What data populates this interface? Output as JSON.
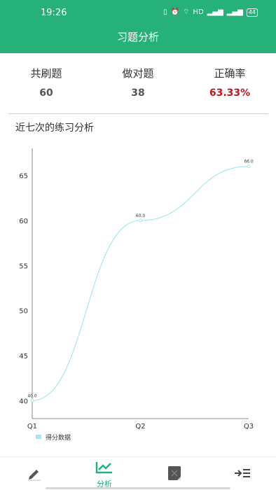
{
  "status": {
    "time": "19:26",
    "network": "HD",
    "battery": "44"
  },
  "app_bar": {
    "title": "习题分析"
  },
  "stats": [
    {
      "label": "共刷题",
      "value": "60"
    },
    {
      "label": "做对题",
      "value": "38"
    },
    {
      "label": "正确率",
      "value": "63.33%"
    }
  ],
  "section": {
    "title": "近七次的练习分析"
  },
  "chart_data": {
    "type": "line",
    "categories": [
      "Q1",
      "Q2",
      "Q3"
    ],
    "series": [
      {
        "name": "得分数据",
        "values": [
          40.0,
          60.0,
          66.0
        ],
        "color": "#a8e6f3"
      }
    ],
    "data_labels": [
      "40.0",
      "60.0",
      "66.0"
    ],
    "yticks": [
      "40",
      "45",
      "50",
      "55",
      "60",
      "65"
    ],
    "ylim": [
      38,
      68
    ],
    "legend": "bottom-left"
  },
  "bottom_nav": {
    "active_label": "分析"
  },
  "colors": {
    "primary": "#26b07a",
    "rate": "#c0161d"
  }
}
